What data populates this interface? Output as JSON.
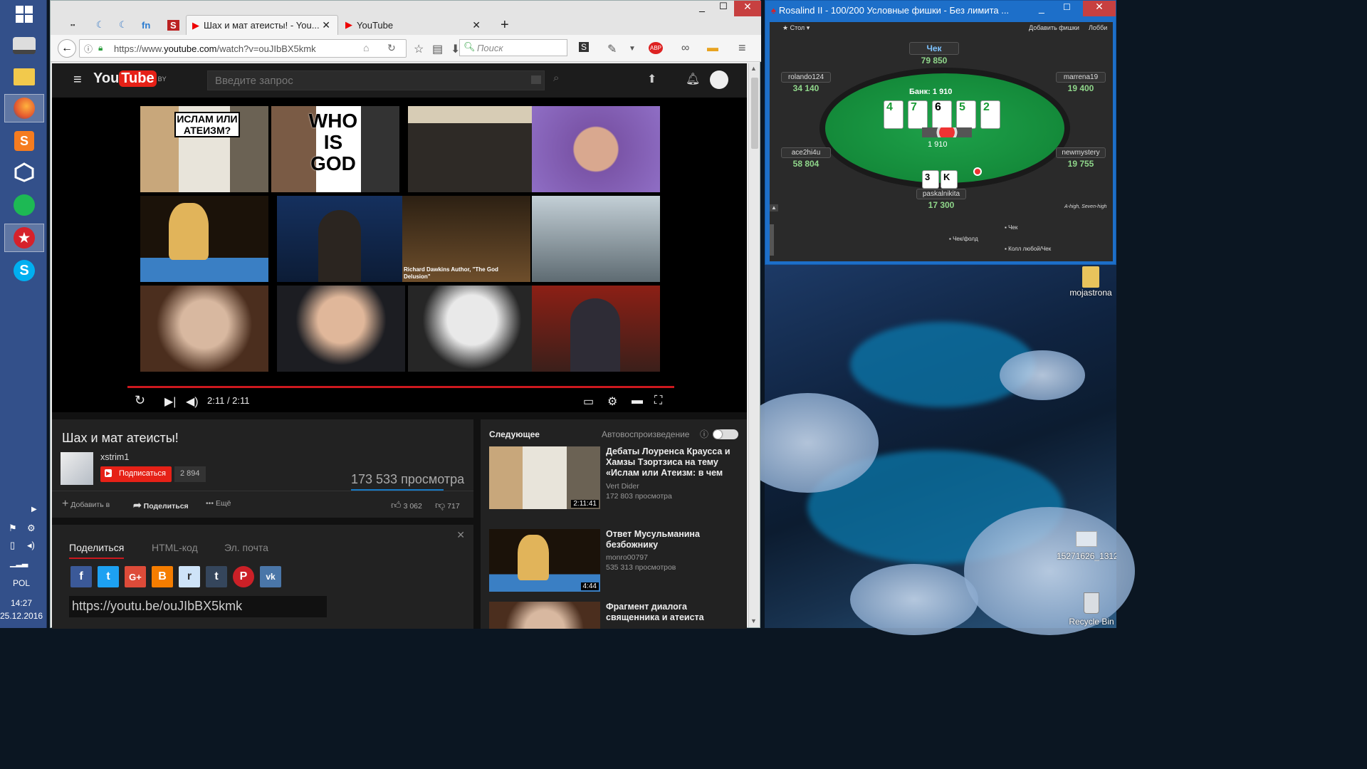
{
  "taskbar": {
    "apps": [
      "windows-logo-icon",
      "storage-drive-icon",
      "file-explorer-icon",
      "firefox-icon",
      "sublime-text-icon",
      "unity-icon",
      "spotify-icon",
      "pokerstars-icon",
      "skype-icon"
    ],
    "language": "POL",
    "time": "14:27",
    "date": "25.12.2016"
  },
  "browser": {
    "tabs": [
      {
        "label": "Шах и мат атеисты! - You...",
        "active": true
      },
      {
        "label": "YouTube",
        "active": false
      }
    ],
    "url_prefix": "https://www.",
    "url_domain": "youtube.com",
    "url_path": "/watch?v=ouJIbBX5kmk",
    "search_placeholder": "Поиск",
    "adblock_label": "ABP"
  },
  "youtube": {
    "logo": "YouTube",
    "region": "BY",
    "search_placeholder": "Введите запрос",
    "player": {
      "time": "2:11 / 2:11",
      "progress": 1.0,
      "thumbnails": [
        {
          "caption": "ИСЛАМ ИЛИ АТЕИЗМ?"
        },
        {
          "caption": "WHO IS GOD"
        },
        {
          "caption": ""
        },
        {
          "caption": ""
        },
        {
          "caption": ""
        },
        {
          "caption": ""
        },
        {
          "caption": "Richard Dawkins Author, \"The God Delusion\""
        },
        {
          "caption": ""
        },
        {
          "caption": ""
        },
        {
          "caption": ""
        },
        {
          "caption": ""
        },
        {
          "caption": ""
        }
      ]
    },
    "video": {
      "title": "Шах и мат атеисты!",
      "channel": "xstrim1",
      "subscribe_label": "Подписаться",
      "subscribers": "2 894",
      "views": "173 533 просмотра",
      "add_label": "Добавить в",
      "share_label": "Поделиться",
      "more_label": "Ещё",
      "likes": "3 062",
      "dislikes": "717"
    },
    "share": {
      "tabs": [
        "Поделиться",
        "HTML-код",
        "Эл. почта"
      ],
      "link": "https://youtu.be/ouJIbBX5kmk",
      "networks": [
        "f",
        "t",
        "G+",
        "B",
        "r",
        "t",
        "P",
        "vk"
      ]
    },
    "sidebar": {
      "next_label": "Следующее",
      "autoplay_label": "Автовоспроизведение",
      "items": [
        {
          "title": "Дебаты Лоуренса Краусса и Хамзы Тзортзиса на тему «Ислам или Атеизм: в чем",
          "channel": "Vert Dider",
          "views": "172 803 просмотра",
          "duration": "2:11:41"
        },
        {
          "title": "Ответ Мусульманина безбожнику",
          "channel": "monro00797",
          "views": "535 313 просмотров",
          "duration": "4:44"
        },
        {
          "title": "Фрагмент диалога священника и атеиста",
          "channel": "",
          "views": "",
          "duration": ""
        }
      ]
    }
  },
  "poker": {
    "window_title": "Rosalind II - 100/200 Условные фишки - Без лимита ...",
    "menu_table": "Стол",
    "menu_add_chips": "Добавить фишки",
    "menu_lobby": "Лобби",
    "pot": "Банк: 1 910",
    "pot_chips": "1 910",
    "seats": [
      {
        "name": "Чек",
        "stack": "79 850"
      },
      {
        "name": "rolando124",
        "stack": "34 140"
      },
      {
        "name": "marrena19",
        "stack": "19 400"
      },
      {
        "name": "ace2hi4u",
        "stack": "58 804"
      },
      {
        "name": "newmystery",
        "stack": "19 755"
      },
      {
        "name": "paskalnikita",
        "stack": "17 300"
      }
    ],
    "board": [
      "4",
      "7",
      "6",
      "5",
      "2"
    ],
    "hero_cards": [
      "3",
      "K"
    ],
    "hand_label": "A-high, Seven-high",
    "options": [
      "Чек",
      "Чек/фолд",
      "Колл любой/Чек"
    ]
  },
  "desktop": {
    "icons": [
      {
        "label": "mojastrona"
      },
      {
        "label": "15271626_1312..."
      },
      {
        "label": "Recycle Bin"
      }
    ]
  }
}
